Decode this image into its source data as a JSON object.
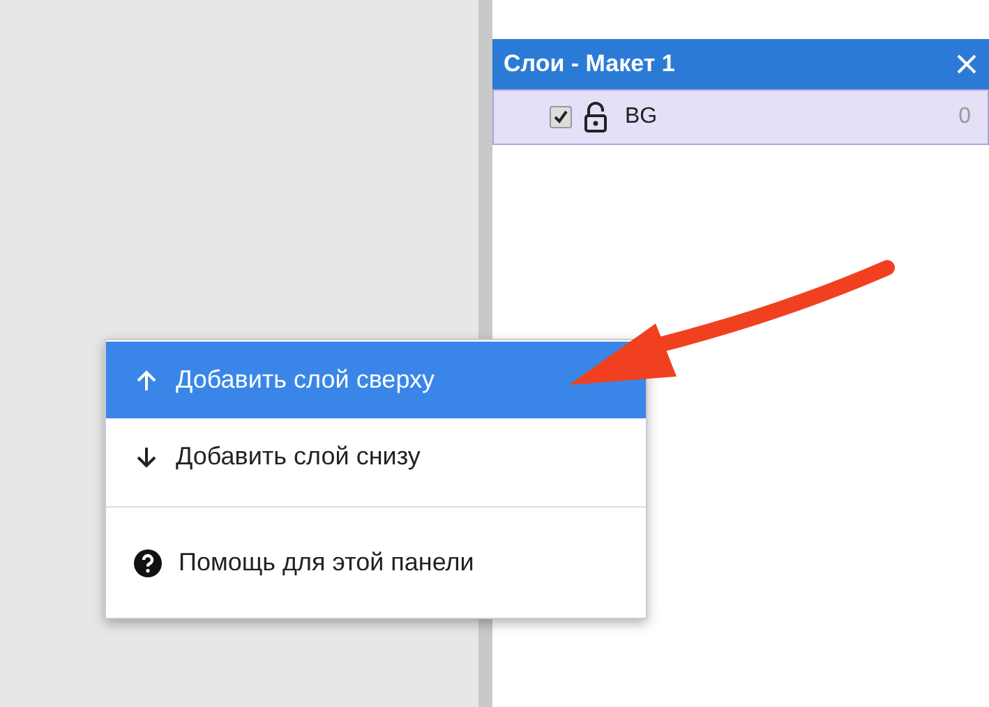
{
  "panel": {
    "title": "Слои - Макет 1"
  },
  "layers": [
    {
      "name": "BG",
      "visible": true,
      "value": "0",
      "selected": true
    }
  ],
  "context_menu": {
    "groups": [
      {
        "items": [
          {
            "kind": "up",
            "label": "Добавить слой сверху",
            "selected": true
          },
          {
            "kind": "down",
            "label": "Добавить слой снизу",
            "selected": false
          }
        ]
      },
      {
        "items": [
          {
            "kind": "help",
            "label": "Помощь для этой панели",
            "selected": false
          }
        ]
      }
    ]
  }
}
